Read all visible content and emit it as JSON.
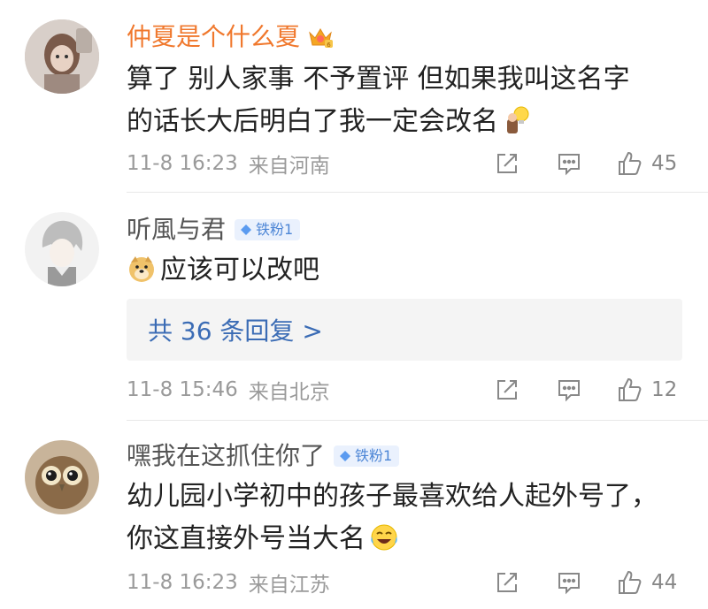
{
  "comments": [
    {
      "user": "仲夏是个什么夏",
      "badge_icon": "vip-crown-icon",
      "content_lines": [
        "算了  别人家事  不予置评  但如果我叫这名字",
        "的话长大后明白了我一定会改名"
      ],
      "content_emoji": "thinking-lightbulb-emoji",
      "time": "11-8 16:23",
      "location": "来自河南",
      "likes": "45"
    },
    {
      "user": "听風与君",
      "fan_badge": "铁粉1",
      "content_lines": [
        "应该可以改吧"
      ],
      "content_emoji": "doge-emoji",
      "replies_label": "共 36 条回复 >",
      "time": "11-8 15:46",
      "location": "来自北京",
      "likes": "12"
    },
    {
      "user": "嘿我在这抓住你了",
      "fan_badge": "铁粉1",
      "content_lines": [
        "幼儿园小学初中的孩子最喜欢给人起外号了，",
        "你这直接外号当大名"
      ],
      "content_emoji": "laugh-cry-emoji",
      "time": "11-8 16:23",
      "location": "来自江苏",
      "likes": "44"
    }
  ],
  "colors": {
    "vip_name": "#f0782d",
    "normal_name": "#555555",
    "meta_gray": "#9a9a9a",
    "reply_link": "#3b6cb5",
    "fan_badge_bg": "#eaf1fd",
    "fan_badge_text": "#4d86d6"
  }
}
